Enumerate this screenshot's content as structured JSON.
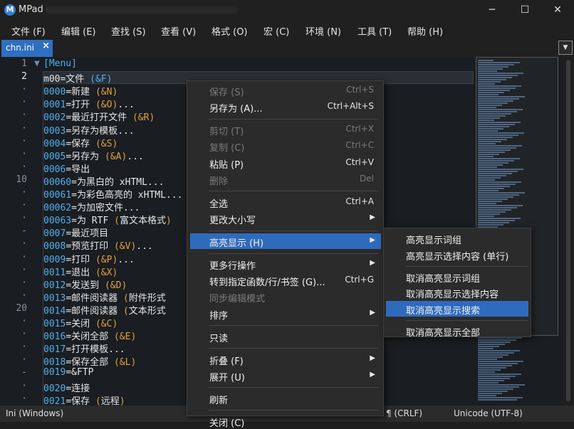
{
  "window": {
    "app_name": "MPad -",
    "controls": {
      "minimize": "─",
      "maximize": "☐",
      "close": "✕"
    }
  },
  "menubar": [
    "文件 (F)",
    "编辑 (E)",
    "查找 (S)",
    "查看 (V)",
    "格式 (O)",
    "宏 (C)",
    "环境 (N)",
    "工具 (T)",
    "帮助 (H)"
  ],
  "tab": {
    "label": "chn.ini",
    "close": "×"
  },
  "editor": {
    "line_numbers": [
      "1",
      "2",
      "·",
      "·",
      "·",
      "·",
      "·",
      "·",
      "·",
      "10",
      "·",
      "·",
      "·",
      "-",
      "·",
      "·",
      "·",
      "·",
      "·",
      "20",
      "·",
      "·",
      "·",
      "·",
      "-",
      "·",
      "·"
    ],
    "lines": [
      [
        {
          "t": "[Menu]",
          "c": "sect"
        }
      ],
      [
        {
          "t": "m00=文件 "
        },
        {
          "t": "(&F)",
          "c": "k"
        }
      ],
      [
        {
          "t": "0000",
          "c": "k"
        },
        {
          "t": "=新建 "
        },
        {
          "t": "(&N)",
          "c": "b"
        }
      ],
      [
        {
          "t": "0001",
          "c": "k"
        },
        {
          "t": "=打开 "
        },
        {
          "t": "(&O)",
          "c": "b"
        },
        {
          "t": "..."
        }
      ],
      [
        {
          "t": "0002",
          "c": "k"
        },
        {
          "t": "=最近打开文件 "
        },
        {
          "t": "(&R)",
          "c": "b"
        }
      ],
      [
        {
          "t": "0003",
          "c": "k"
        },
        {
          "t": "=另存为模板..."
        }
      ],
      [
        {
          "t": "0004",
          "c": "k"
        },
        {
          "t": "=保存 "
        },
        {
          "t": "(&S)",
          "c": "b"
        }
      ],
      [
        {
          "t": "0005",
          "c": "k"
        },
        {
          "t": "=另存为 "
        },
        {
          "t": "(&A)",
          "c": "b"
        },
        {
          "t": "..."
        }
      ],
      [
        {
          "t": "0006",
          "c": "k"
        },
        {
          "t": "=导出"
        }
      ],
      [
        {
          "t": "00060",
          "c": "k"
        },
        {
          "t": "=为黑白的 xHTML..."
        }
      ],
      [
        {
          "t": "00061",
          "c": "k"
        },
        {
          "t": "=为彩色高亮的 xHTML..."
        }
      ],
      [
        {
          "t": "00062",
          "c": "k"
        },
        {
          "t": "=为加密文件..."
        }
      ],
      [
        {
          "t": "00063",
          "c": "k"
        },
        {
          "t": "=为 RTF "
        },
        {
          "t": "(",
          "c": "b"
        },
        {
          "t": "富文本格式"
        },
        {
          "t": ")",
          "c": "b"
        }
      ],
      [
        {
          "t": "0007",
          "c": "k"
        },
        {
          "t": "=最近项目"
        }
      ],
      [
        {
          "t": "0008",
          "c": "k"
        },
        {
          "t": "=预览打印 "
        },
        {
          "t": "(&V)",
          "c": "b"
        },
        {
          "t": "..."
        }
      ],
      [
        {
          "t": "0009",
          "c": "k"
        },
        {
          "t": "=打印 "
        },
        {
          "t": "(&P)",
          "c": "b"
        },
        {
          "t": "..."
        }
      ],
      [
        {
          "t": "0011",
          "c": "k"
        },
        {
          "t": "=退出 "
        },
        {
          "t": "(&X)",
          "c": "b"
        }
      ],
      [
        {
          "t": "0012",
          "c": "k"
        },
        {
          "t": "=发送到 "
        },
        {
          "t": "(&D)",
          "c": "b"
        }
      ],
      [
        {
          "t": "0013",
          "c": "k"
        },
        {
          "t": "=邮件阅读器 "
        },
        {
          "t": "(",
          "c": "b"
        },
        {
          "t": "附件形式"
        }
      ],
      [
        {
          "t": "0014",
          "c": "k"
        },
        {
          "t": "=邮件阅读器 "
        },
        {
          "t": "(",
          "c": "b"
        },
        {
          "t": "文本形式"
        }
      ],
      [
        {
          "t": "0015",
          "c": "k"
        },
        {
          "t": "=关闭 "
        },
        {
          "t": "(&C)",
          "c": "b"
        }
      ],
      [
        {
          "t": "0016",
          "c": "k"
        },
        {
          "t": "=关闭全部 "
        },
        {
          "t": "(&E)",
          "c": "b"
        }
      ],
      [
        {
          "t": "0017",
          "c": "k"
        },
        {
          "t": "=打开模板..."
        }
      ],
      [
        {
          "t": "0018",
          "c": "k"
        },
        {
          "t": "=保存全部 "
        },
        {
          "t": "(&L)",
          "c": "b"
        }
      ],
      [
        {
          "t": "0019",
          "c": "k"
        },
        {
          "t": "=&FTP"
        }
      ],
      [
        {
          "t": "0020",
          "c": "k"
        },
        {
          "t": "=连接"
        }
      ],
      [
        {
          "t": "0021",
          "c": "k"
        },
        {
          "t": "=保存 "
        },
        {
          "t": "(",
          "c": "b"
        },
        {
          "t": "远程"
        },
        {
          "t": ")",
          "c": "b"
        }
      ]
    ]
  },
  "context_menu": [
    {
      "label": "保存 (S)",
      "shortcut": "Ctrl+S",
      "disabled": true
    },
    {
      "label": "另存为 (A)...",
      "shortcut": "Ctrl+Alt+S"
    },
    {
      "sep": true
    },
    {
      "label": "剪切 (T)",
      "shortcut": "Ctrl+X",
      "disabled": true
    },
    {
      "label": "复制 (C)",
      "shortcut": "Ctrl+C",
      "disabled": true
    },
    {
      "label": "粘贴 (P)",
      "shortcut": "Ctrl+V"
    },
    {
      "label": "删除",
      "shortcut": "Del",
      "disabled": true
    },
    {
      "sep": true
    },
    {
      "label": "全选",
      "shortcut": "Ctrl+A"
    },
    {
      "label": "更改大小写",
      "submenu": true
    },
    {
      "sep": true
    },
    {
      "label": "高亮显示 (H)",
      "submenu": true,
      "highlighted": true
    },
    {
      "sep": true
    },
    {
      "label": "更多行操作",
      "submenu": true
    },
    {
      "label": "转到指定函数/行/书签 (G)...",
      "shortcut": "Ctrl+G"
    },
    {
      "label": "同步编辑模式",
      "disabled": true
    },
    {
      "label": "排序",
      "submenu": true
    },
    {
      "sep": true
    },
    {
      "label": "只读"
    },
    {
      "sep": true
    },
    {
      "label": "折叠 (F)",
      "submenu": true
    },
    {
      "label": "展开 (U)",
      "submenu": true
    },
    {
      "sep": true
    },
    {
      "label": "刷新"
    },
    {
      "sep": true
    },
    {
      "label": "关闭 (C)"
    }
  ],
  "submenu": [
    {
      "label": "高亮显示词组"
    },
    {
      "label": "高亮显示选择内容 (单行)"
    },
    {
      "sep": true
    },
    {
      "label": "取消高亮显示词组"
    },
    {
      "label": "取消高亮显示选择内容"
    },
    {
      "label": "取消高亮显示搜索",
      "highlighted": true
    },
    {
      "sep": true
    },
    {
      "label": "取消高亮显示全部"
    }
  ],
  "statusbar": {
    "syntax": "Ini (Windows)",
    "line_ending": "¶ (CRLF)",
    "encoding": "Unicode (UTF-8)"
  }
}
